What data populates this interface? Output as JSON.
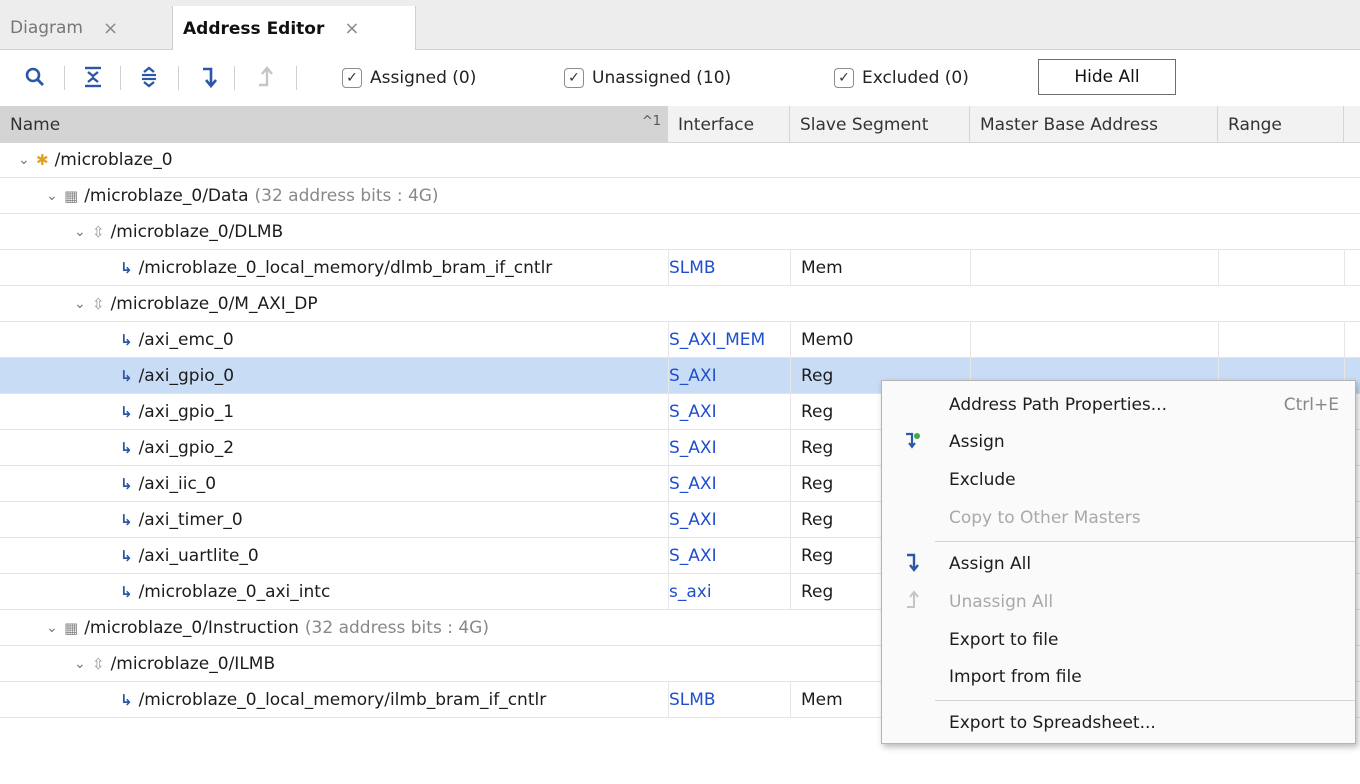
{
  "tabs": [
    {
      "label": "Diagram",
      "close": "×"
    },
    {
      "label": "Address Editor",
      "close": "×"
    }
  ],
  "toolbar": {
    "icons": [
      "search-icon",
      "collapse-all-icon",
      "expand-all-icon",
      "assign-all-icon",
      "unassign-all-icon"
    ],
    "filters": [
      {
        "label": "Assigned (0)",
        "checked": true
      },
      {
        "label": "Unassigned (10)",
        "checked": true
      },
      {
        "label": "Excluded (0)",
        "checked": true
      }
    ],
    "hide_all_label": "Hide All"
  },
  "table": {
    "columns": [
      "Name",
      "Interface",
      "Slave Segment",
      "Master Base Address",
      "Range"
    ],
    "sort_indicator": "^1",
    "rows": [
      {
        "name": "/microblaze_0",
        "interface": "",
        "segment": "",
        "meta": ""
      },
      {
        "name": "/microblaze_0/Data",
        "interface": "",
        "segment": "",
        "meta": "(32 address bits : 4G)"
      },
      {
        "name": "/microblaze_0/DLMB",
        "interface": "",
        "segment": "",
        "meta": ""
      },
      {
        "name": "/microblaze_0_local_memory/dlmb_bram_if_cntlr",
        "interface": "SLMB",
        "segment": "Mem",
        "meta": ""
      },
      {
        "name": "/microblaze_0/M_AXI_DP",
        "interface": "",
        "segment": "",
        "meta": ""
      },
      {
        "name": "/axi_emc_0",
        "interface": "S_AXI_MEM",
        "segment": "Mem0",
        "meta": ""
      },
      {
        "name": "/axi_gpio_0",
        "interface": "S_AXI",
        "segment": "Reg",
        "meta": ""
      },
      {
        "name": "/axi_gpio_1",
        "interface": "S_AXI",
        "segment": "Reg",
        "meta": ""
      },
      {
        "name": "/axi_gpio_2",
        "interface": "S_AXI",
        "segment": "Reg",
        "meta": ""
      },
      {
        "name": "/axi_iic_0",
        "interface": "S_AXI",
        "segment": "Reg",
        "meta": ""
      },
      {
        "name": "/axi_timer_0",
        "interface": "S_AXI",
        "segment": "Reg",
        "meta": ""
      },
      {
        "name": "/axi_uartlite_0",
        "interface": "S_AXI",
        "segment": "Reg",
        "meta": ""
      },
      {
        "name": "/microblaze_0_axi_intc",
        "interface": "s_axi",
        "segment": "Reg",
        "meta": ""
      },
      {
        "name": "/microblaze_0/Instruction",
        "interface": "",
        "segment": "",
        "meta": "(32 address bits : 4G)"
      },
      {
        "name": "/microblaze_0/ILMB",
        "interface": "",
        "segment": "",
        "meta": ""
      },
      {
        "name": "/microblaze_0_local_memory/ilmb_bram_if_cntlr",
        "interface": "SLMB",
        "segment": "Mem",
        "meta": ""
      }
    ]
  },
  "context_menu": {
    "items": [
      {
        "label": "Address Path Properties...",
        "shortcut": "Ctrl+E"
      },
      {
        "label": "Assign",
        "icon": "assign-icon"
      },
      {
        "label": "Exclude"
      },
      {
        "label": "Copy to Other Masters",
        "disabled": true
      },
      {
        "label": "Assign All",
        "icon": "assign-all-icon"
      },
      {
        "label": "Unassign All",
        "icon": "unassign-all-icon",
        "disabled": true
      },
      {
        "label": "Export to file"
      },
      {
        "label": "Import from file"
      },
      {
        "label": "Export to Spreadsheet..."
      }
    ]
  },
  "colors": {
    "selection": "#c9dcf5",
    "interface_link": "#1f4fd0",
    "toolbar_icon": "#2c56a8",
    "microblaze_icon": "#e0a126"
  }
}
